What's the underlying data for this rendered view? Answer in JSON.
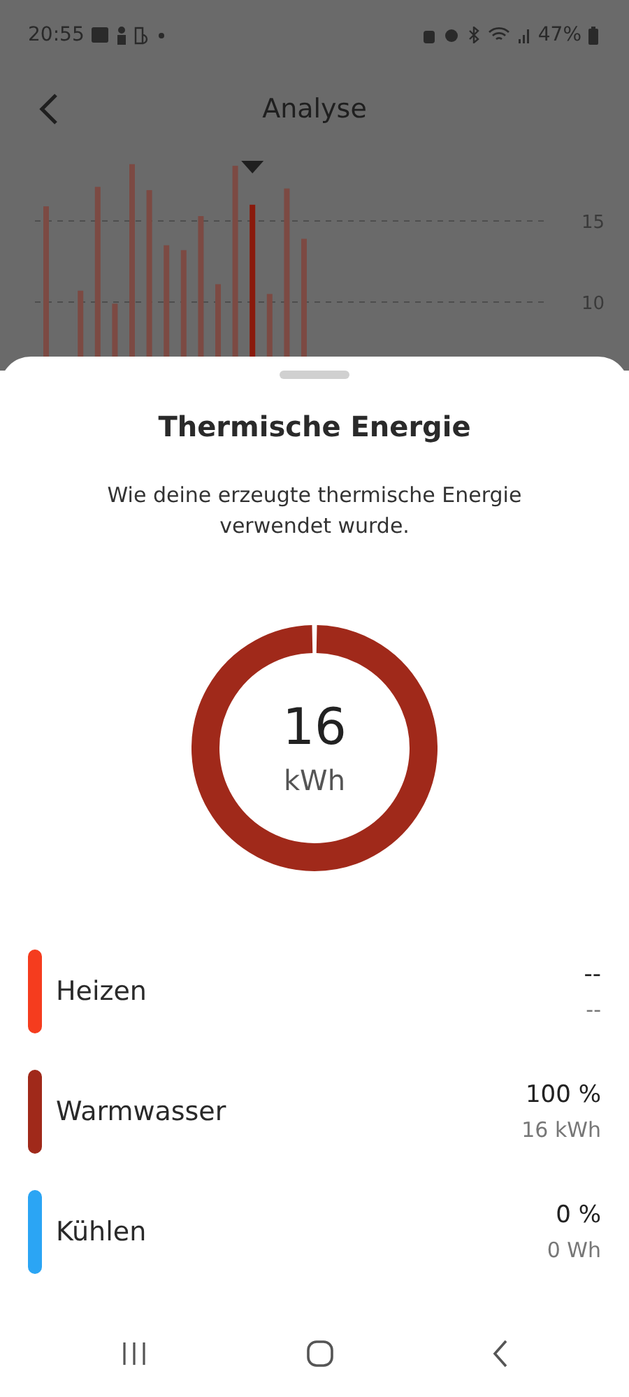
{
  "status_bar": {
    "time": "20:55",
    "battery": "47%"
  },
  "header": {
    "title": "Analyse"
  },
  "background_chart": {
    "axis_labels": [
      "15",
      "10"
    ]
  },
  "sheet": {
    "title": "Thermische Energie",
    "description": "Wie deine erzeugte thermische Energie verwendet wurde.",
    "donut": {
      "value": "16",
      "unit": "kWh",
      "color": "#a0291a"
    },
    "legend": [
      {
        "label": "Heizen",
        "color": "#f53c1e",
        "share": "--",
        "amount": "--"
      },
      {
        "label": "Warmwasser",
        "color": "#a0291a",
        "share": "100 %",
        "amount": "16 kWh"
      },
      {
        "label": "Kühlen",
        "color": "#2ba5f4",
        "share": "0 %",
        "amount": "0 Wh"
      }
    ]
  }
}
